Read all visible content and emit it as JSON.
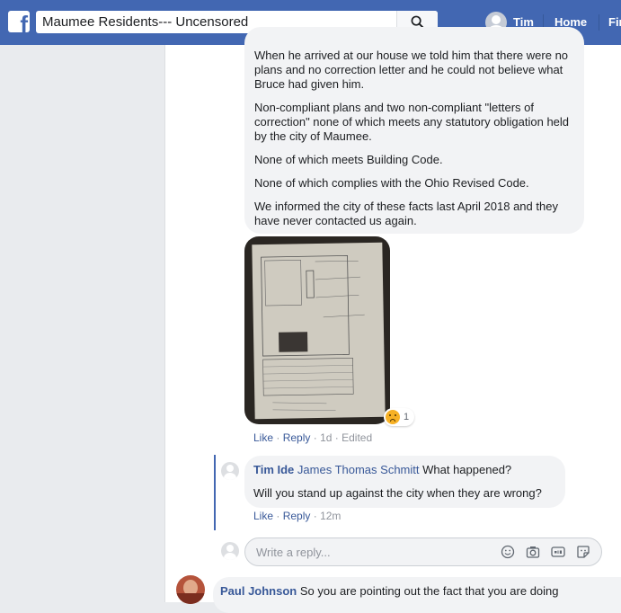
{
  "topbar": {
    "logo_letter": "f",
    "search_value": "Maumee Residents--- Uncensored",
    "user_name": "Tim",
    "home_label": "Home",
    "find_label": "Fin"
  },
  "comment": {
    "paragraphs": [
      "When he arrived at our house we told him that there were no plans and no correction letter and he could not believe what Bruce had given him.",
      "Non-compliant plans and two non-compliant \"letters of correction\" none of which meets any statutory obligation held by the city of Maumee.",
      "None of which meets Building Code.",
      "None of which complies with the Ohio Revised Code.",
      "We informed the city of these facts last April 2018 and they have never contacted us again."
    ],
    "reaction_count": "1",
    "actions": {
      "like": "Like",
      "reply": "Reply",
      "time": "1d",
      "edited": "Edited"
    }
  },
  "reply": {
    "author": "Tim Ide",
    "mention": "James Thomas Schmitt",
    "text_line1": "What happened?",
    "text_line2": "Will you stand up against the city when they are wrong?",
    "actions": {
      "like": "Like",
      "reply": "Reply",
      "time": "12m"
    }
  },
  "reply_box": {
    "placeholder": "Write a reply..."
  },
  "next_comment": {
    "author": "Paul Johnson",
    "text": "So you are pointing out the fact that you are doing"
  }
}
